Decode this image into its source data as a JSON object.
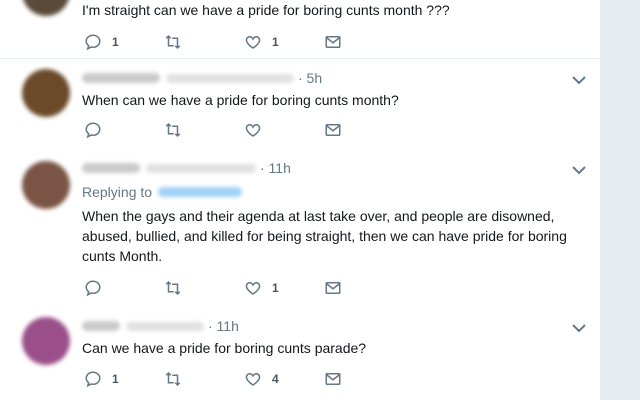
{
  "tweets": [
    {
      "text": "I'm straight can we have a pride for boring cunts month ???",
      "replies": "1",
      "retweets": "",
      "likes": "1",
      "avatar_color": "#5a4a3a"
    },
    {
      "time": "· 5h",
      "text": "When can we have a pride for boring cunts month?",
      "replies": "",
      "retweets": "",
      "likes": "",
      "avatar_color": "#6b4a2a"
    },
    {
      "time": "· 11h",
      "replying_label": "Replying to",
      "text": "When the gays and their agenda at last take over, and people are disowned, abused, bullied, and killed for being straight, then we can have pride for boring cunts Month.",
      "replies": "",
      "retweets": "",
      "likes": "1",
      "avatar_color": "#7a5545"
    },
    {
      "time": "· 11h",
      "text": "Can we have a pride for boring cunts parade?",
      "replies": "1",
      "retweets": "",
      "likes": "4",
      "avatar_color": "#9a4f8a"
    }
  ],
  "icons": {
    "reply": "reply-icon",
    "retweet": "retweet-icon",
    "like": "heart-icon",
    "dm": "envelope-icon",
    "menu": "chevron-down-icon"
  },
  "colors": {
    "muted": "#657786",
    "background": "#e6ecf0",
    "link_blur": "#9fd0f5"
  }
}
